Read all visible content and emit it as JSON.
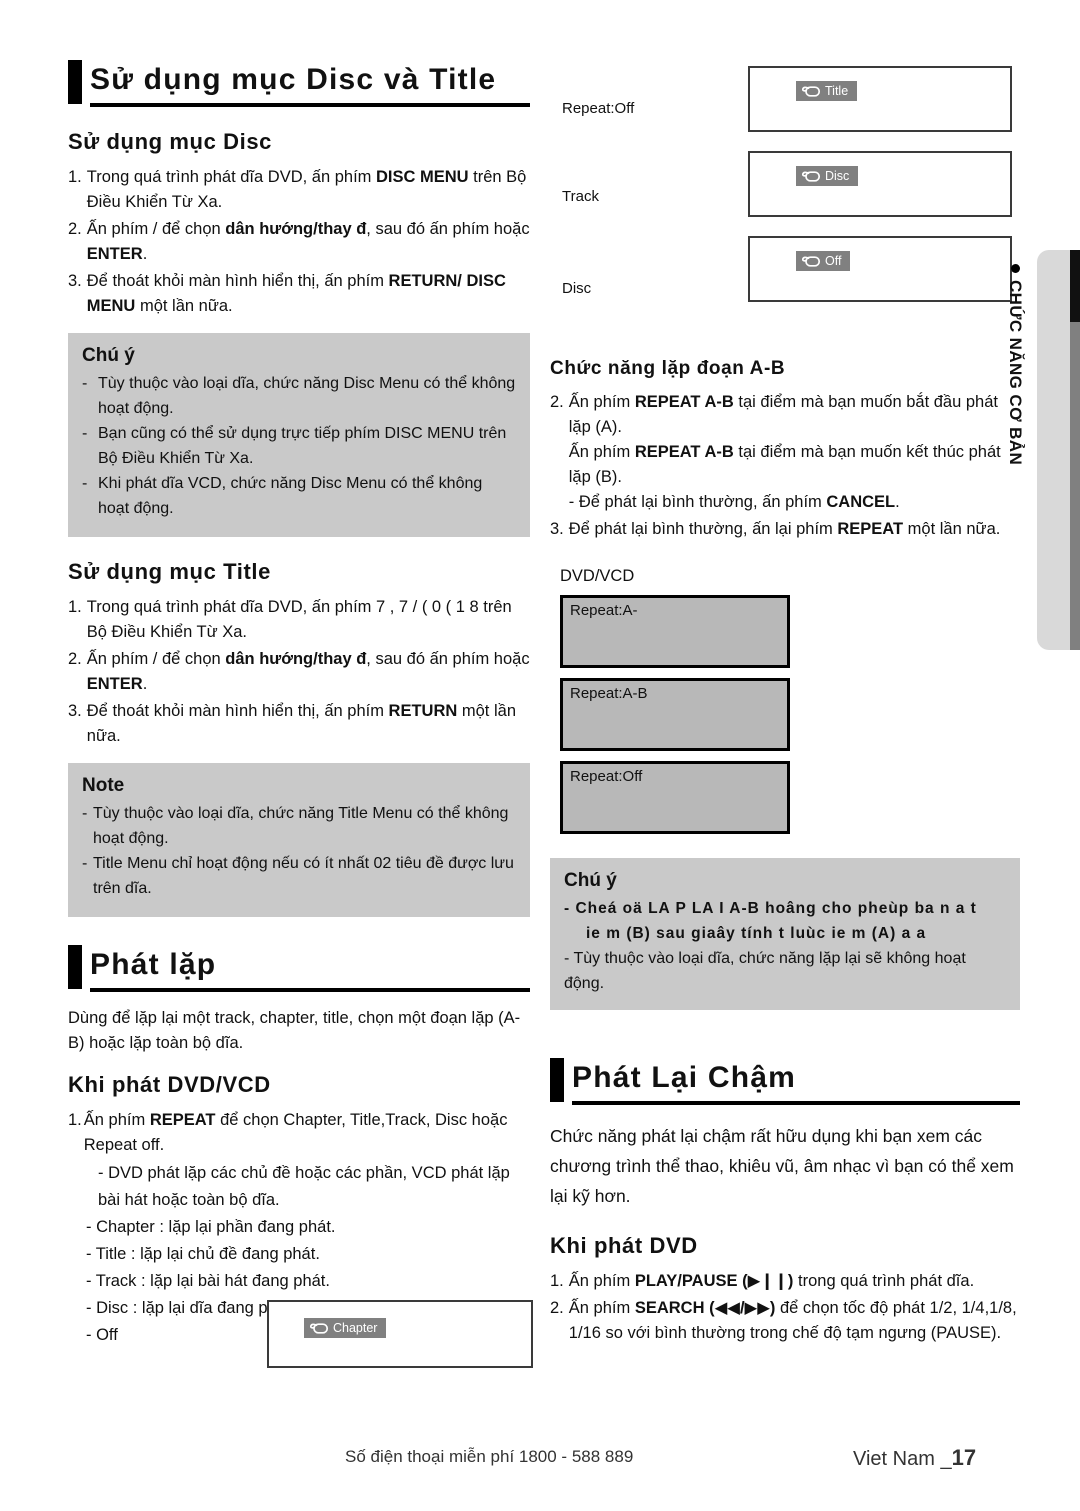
{
  "sections": {
    "disc_title": {
      "heading": "Sử dụng mục Disc và Title",
      "sub_disc": "Sử dụng mục Disc",
      "disc_steps": [
        {
          "num": "1.",
          "parts": [
            {
              "t": "Trong quá trình phát dĩa DVD, ấn phím ",
              "b": false
            },
            {
              "t": "DISC MENU",
              "b": true
            },
            {
              "t": " trên Bộ Điều Khiển Từ Xa.",
              "b": false
            }
          ]
        },
        {
          "num": "2.",
          "parts": [
            {
              "t": "Ấn phím    /    để chọn ",
              "b": false
            },
            {
              "t": "dân hướng/thay đ",
              "b": true
            },
            {
              "t": ", sau đó ấn phím hoặc ",
              "b": false
            },
            {
              "t": "ENTER",
              "b": true
            },
            {
              "t": ".",
              "b": false
            }
          ]
        },
        {
          "num": "3.",
          "parts": [
            {
              "t": "Để thoát khỏi màn hình hiển thị, ấn phím ",
              "b": false
            },
            {
              "t": "RETURN/ DISC MENU",
              "b": true
            },
            {
              "t": " một lần nữa.",
              "b": false
            }
          ]
        }
      ],
      "note_disc": {
        "title": "Chú ý",
        "items": [
          "Tùy thuộc vào loại dĩa, chức năng Disc Menu có thể không hoạt động.",
          "Bạn cũng có thể sử dụng trực tiếp phím DISC MENU trên Bộ Điều Khiển Từ Xa.",
          "Khi phát dĩa VCD, chức năng Disc Menu có thể không hoạt động."
        ]
      },
      "sub_title": "Sử dụng mục Title",
      "title_steps": [
        {
          "num": "1.",
          "parts": [
            {
              "t": "Trong quá trình phát dĩa DVD, ấn phím        ",
              "b": false
            },
            {
              "t": "7 , 7 / (   0 ( 1 8",
              "b": false
            },
            {
              "t": " trên Bộ Điều Khiển Từ Xa.",
              "b": false
            }
          ]
        },
        {
          "num": "2.",
          "parts": [
            {
              "t": "Ấn phím    /    để chọn ",
              "b": false
            },
            {
              "t": "dân hướng/thay đ",
              "b": true
            },
            {
              "t": ", sau đó ấn phím hoặc ",
              "b": false
            },
            {
              "t": "ENTER",
              "b": true
            },
            {
              "t": ".",
              "b": false
            }
          ]
        },
        {
          "num": "3.",
          "parts": [
            {
              "t": "Để thoát khỏi màn hình hiển thị, ấn phím ",
              "b": false
            },
            {
              "t": "RETURN",
              "b": true
            },
            {
              "t": " một lần nữa.",
              "b": false
            }
          ]
        }
      ],
      "note_title": {
        "title": "Note",
        "items": [
          "Tùy thuộc vào loại dĩa, chức năng Title Menu có thể không hoạt động.",
          "Title Menu chỉ hoạt động nếu có ít nhất 02 tiêu đề được lưu trên dĩa."
        ]
      }
    },
    "phat_lap": {
      "heading": "Phát lặp",
      "intro": "Dùng để lặp lại một track, chapter, title, chọn một đoạn lặp (A-B) hoặc lặp toàn bộ dĩa.",
      "sub": "Khi phát DVD/VCD",
      "step1": {
        "num": "1.",
        "parts": [
          {
            "t": "Ấn phím ",
            "b": false
          },
          {
            "t": "REPEAT",
            "b": true
          },
          {
            "t": " để chọn Chapter, Title,Track, Disc hoặc Repeat off.",
            "b": false
          }
        ]
      },
      "dashes": [
        "- DVD phát lặp các chủ đề hoặc các phần, VCD phát lặp bài hát hoặc toàn bộ dĩa.",
        "- Chapter : lặp lại phần đang phát.",
        "- Title : lặp lại chủ đề đang phát.",
        "- Track : lặp lại bài hát đang phát.",
        "- Disc : lặp lại dĩa đang phát.",
        "- Off"
      ]
    },
    "ab_repeat": {
      "heading": "Chức năng lặp đoạn A-B",
      "step2": {
        "num": "2.",
        "lines": [
          [
            {
              "t": "Ấn phím ",
              "b": false
            },
            {
              "t": "REPEAT A-B",
              "b": true
            },
            {
              "t": " tại điểm mà bạn muốn bắt đầu phát lặp (A).",
              "b": false
            }
          ],
          [
            {
              "t": "Ấn phím ",
              "b": false
            },
            {
              "t": "REPEAT A-B",
              "b": true
            },
            {
              "t": " tại điểm mà bạn muốn kết thúc phát lặp (B).",
              "b": false
            }
          ],
          [
            {
              "t": "- Để phát lại bình thường, ấn phím ",
              "b": false
            },
            {
              "t": "CANCEL",
              "b": true
            },
            {
              "t": ".",
              "b": false
            }
          ]
        ]
      },
      "step3": {
        "num": "3.",
        "parts": [
          {
            "t": "Để phát lại bình thường, ấn lại phím ",
            "b": false
          },
          {
            "t": "REPEAT",
            "b": true
          },
          {
            "t": " một lần nữa.",
            "b": false
          }
        ]
      },
      "dvdvcd_label": "DVD/VCD",
      "osd_boxes": [
        "Repeat:A-",
        "Repeat:A-B",
        "Repeat:Off"
      ],
      "note": {
        "title": "Chú ý",
        "garbled_line1": "- Cheá    oä LA   P LA   I A-B    hoâng cho pheùp ba    n    a   t",
        "garbled_line2": "ie    m (B) sau      giaây tính t        luùc    ie    m (A)    a        a",
        "items": [
          "- Tùy thuộc vào loại dĩa, chức năng lặp lại sẽ không hoạt động."
        ]
      }
    },
    "slow_play": {
      "heading": "Phát Lại Chậm",
      "intro": "Chức năng phát lại chậm rất hữu dụng khi bạn xem các chương trình thể thao, khiêu vũ, âm nhạc vì bạn có thể xem lại kỹ hơn.",
      "sub": "Khi phát DVD",
      "steps": [
        {
          "num": "1.",
          "parts": [
            {
              "t": "Ấn phím ",
              "b": false
            },
            {
              "t": "PLAY/PAUSE (▶❙❙)",
              "b": true
            },
            {
              "t": " trong quá trình phát dĩa.",
              "b": false
            }
          ]
        },
        {
          "num": "2.",
          "parts": [
            {
              "t": "Ấn phím ",
              "b": false
            },
            {
              "t": "SEARCH (◀◀/▶▶)",
              "b": true
            },
            {
              "t": " để chọn tốc độ phát 1/2, 1/4,1/8, 1/16 so với bình thường trong chế độ tạm ngưng (PAUSE).",
              "b": false
            }
          ]
        }
      ]
    }
  },
  "osd_left_labels": [
    "Repeat:Off",
    "Track",
    "Disc"
  ],
  "osd_chips": [
    "Title",
    "Disc",
    "Off"
  ],
  "chapter_chip": "Chapter",
  "side_tab": {
    "label": "CHỨC NĂNG CƠ BẢN"
  },
  "footer": {
    "phone": "Số điện thoại miễn phí 1800 - 588 889",
    "country": "Viet Nam _",
    "page": "17"
  }
}
